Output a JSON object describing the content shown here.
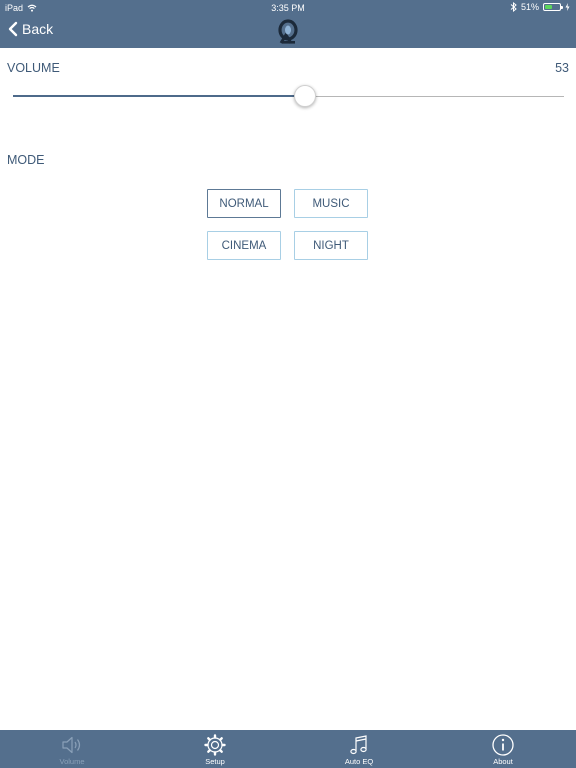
{
  "status_bar": {
    "device": "iPad",
    "time": "3:35 PM",
    "battery_text": "51%",
    "battery_level": 0.51
  },
  "nav": {
    "back_label": "Back",
    "logo_icon": "app-logo-icon"
  },
  "volume": {
    "label": "VOLUME",
    "value": "53",
    "level": 0.53
  },
  "mode": {
    "label": "MODE",
    "options": [
      "NORMAL",
      "MUSIC",
      "CINEMA",
      "NIGHT"
    ],
    "selected": "NORMAL"
  },
  "tabs": [
    {
      "label": "Volume",
      "icon": "speaker-icon",
      "active": true
    },
    {
      "label": "Setup",
      "icon": "gear-icon",
      "active": false
    },
    {
      "label": "Auto EQ",
      "icon": "music-note-icon",
      "active": false
    },
    {
      "label": "About",
      "icon": "info-icon",
      "active": false
    }
  ],
  "colors": {
    "bar": "#546f8d",
    "accent": "#3f5a78",
    "button_border": "#a8cfe5",
    "battery_fill": "#5cd65c"
  }
}
